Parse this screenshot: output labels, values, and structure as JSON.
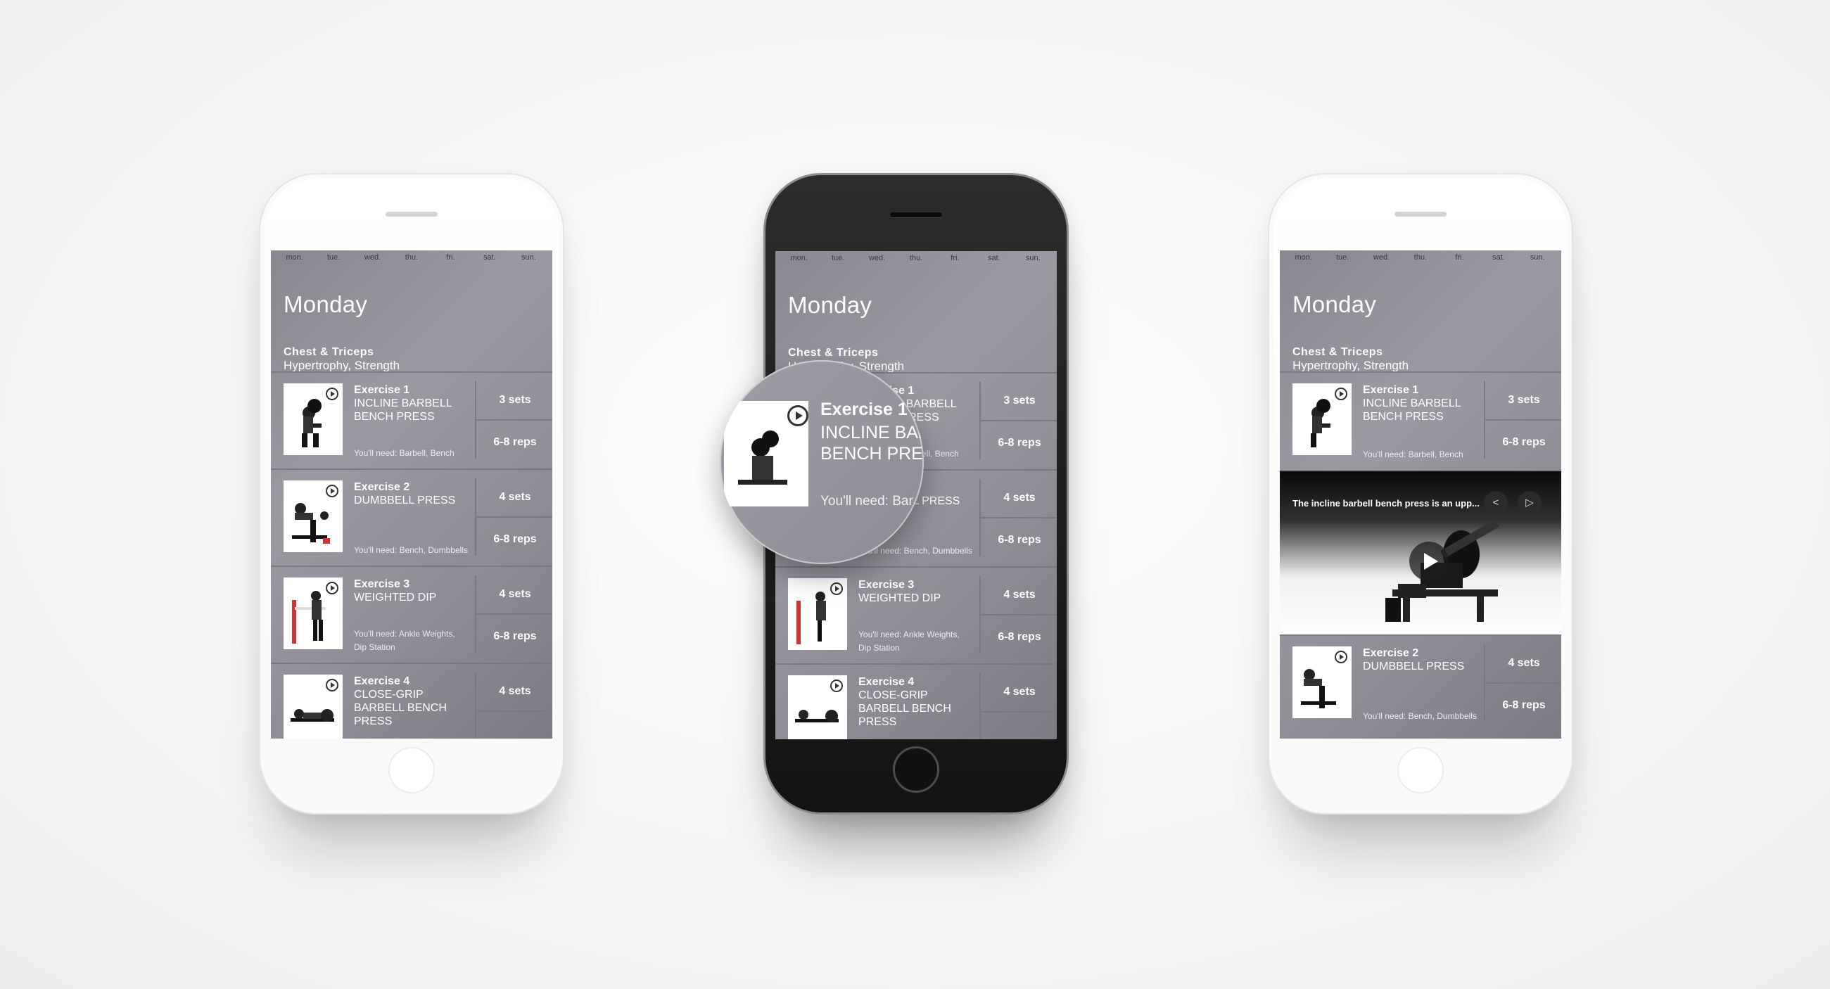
{
  "days": [
    "mon.",
    "tue.",
    "wed.",
    "thu.",
    "fri.",
    "sat.",
    "sun."
  ],
  "day_title": "Monday",
  "workout": {
    "name": "Chest & Triceps",
    "type": "Hypertrophy, Strength"
  },
  "exercises": [
    {
      "number": "Exercise 1",
      "name": "INCLINE BARBELL BENCH PRESS",
      "needs": "You'll need: Barbell, Bench",
      "sets": "3 sets",
      "reps": "6-8 reps"
    },
    {
      "number": "Exercise 2",
      "name": "DUMBBELL PRESS",
      "needs": "You'll need: Bench, Dumbbells",
      "sets": "4 sets",
      "reps": "6-8 reps"
    },
    {
      "number": "Exercise 3",
      "name": "WEIGHTED DIP",
      "needs": "You'll need: Ankle Weights, Dip Station",
      "sets": "4 sets",
      "reps": "6-8 reps"
    },
    {
      "number": "Exercise 4",
      "name": "CLOSE-GRIP BARBELL BENCH PRESS",
      "needs": "",
      "sets": "4 sets",
      "reps": ""
    }
  ],
  "video": {
    "caption": "The incline barbell bench press is an upp...",
    "share_icon": "share-icon",
    "play_icon": "play-icon"
  },
  "magnifier": {
    "number": "Exercise 1",
    "name_line1": "INCLINE BAR",
    "name_line2": "BENCH PRES",
    "needs": "You'll need: Bar"
  }
}
